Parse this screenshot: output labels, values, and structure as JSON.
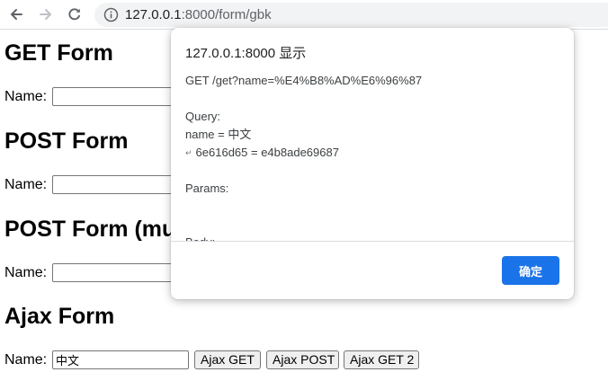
{
  "browser": {
    "url_host": "127.0.0.1",
    "url_path": ":8000/form/gbk"
  },
  "sections": [
    {
      "title": "GET Form",
      "label": "Name:",
      "value": ""
    },
    {
      "title": "POST Form",
      "label": "Name:",
      "value": ""
    },
    {
      "title": "POST Form (multipart)",
      "label": "Name:",
      "value": ""
    },
    {
      "title": "Ajax Form",
      "label": "Name:",
      "value": "中文",
      "buttons": [
        "Ajax GET",
        "Ajax POST",
        "Ajax GET 2"
      ]
    }
  ],
  "dialog": {
    "title": "127.0.0.1:8000 显示",
    "lines": [
      "GET /get?name=%E4%B8%AD%E6%96%87",
      "",
      "Query:",
      "name = 中文",
      "6e616d65 = e4b8ade69687",
      "",
      "Params:",
      "",
      "",
      "Body:"
    ],
    "ok_label": "确定"
  }
}
